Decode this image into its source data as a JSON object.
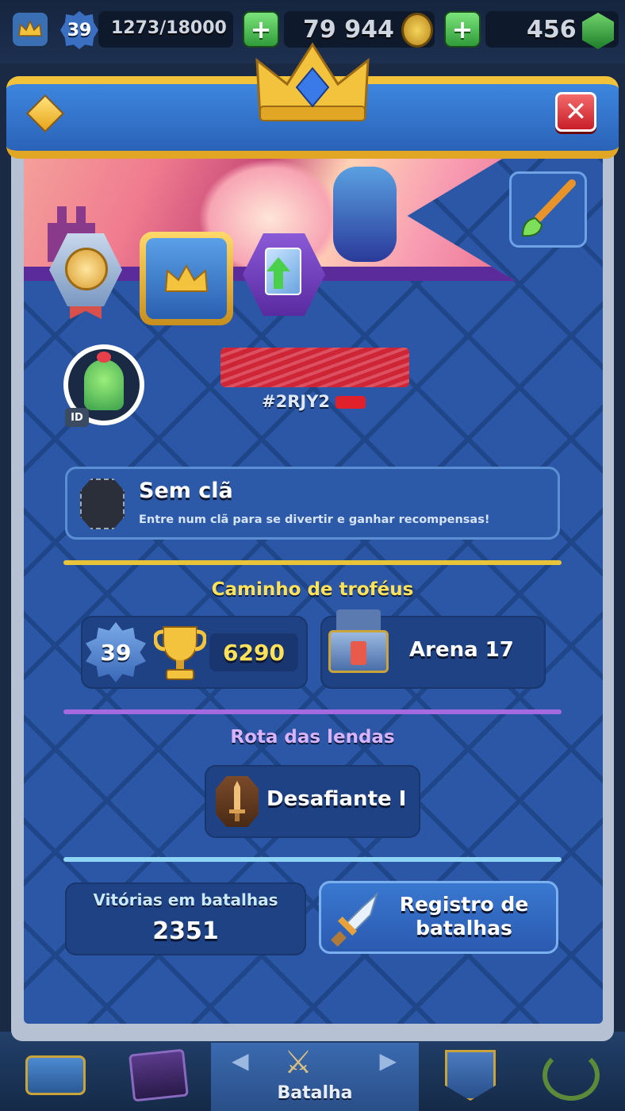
{
  "topbar": {
    "king_level": "39",
    "xp": "1273/18000",
    "gold": "79 944",
    "gems": "456",
    "plus_label": "+"
  },
  "header": {
    "close_label": "✕"
  },
  "player": {
    "tag_visible": "#2RJY2",
    "id_badge": "ID"
  },
  "clan": {
    "title": "Sem clã",
    "subtitle": "Entre num clã para se divertir e ganhar recompensas!"
  },
  "trophy_road": {
    "title": "Caminho de troféus",
    "level": "39",
    "trophies": "6290",
    "arena": "Arena 17"
  },
  "legends": {
    "title": "Rota das lendas",
    "rank": "Desafiante I"
  },
  "stats": {
    "wins_label": "Vitórias em batalhas",
    "wins_value": "2351",
    "log_button": "Registro de batalhas"
  },
  "bottom_nav": {
    "active_label": "Batalha"
  },
  "colors": {
    "gold_accent": "#f2c23a",
    "trophy_road_line": "#e8c43a",
    "legends_line": "#a66ae0",
    "stats_line": "#8fd4f5",
    "title_yellow": "#ffe25a",
    "title_purple": "#d9b3ff"
  }
}
